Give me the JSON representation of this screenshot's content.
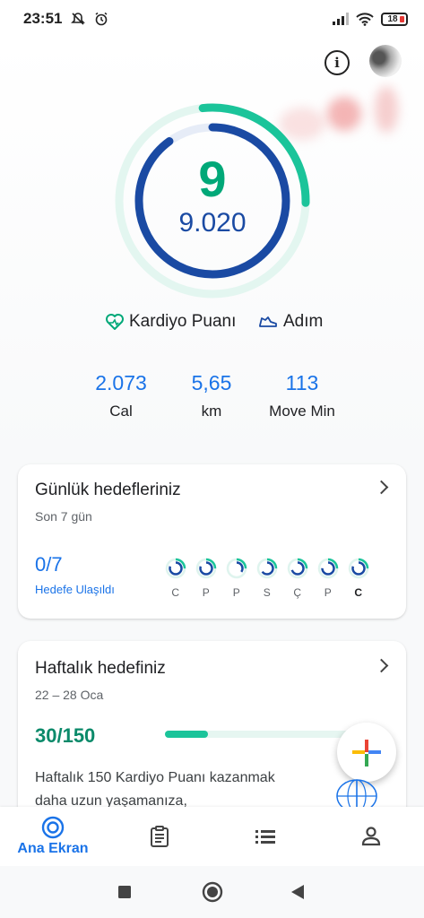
{
  "status_bar": {
    "time": "23:51",
    "battery": "18"
  },
  "ring": {
    "cardio_points": "9",
    "steps": "9.020",
    "cardio_progress": 0.27,
    "steps_progress": 0.9
  },
  "legend": {
    "cardio_label": "Kardiyo Puanı",
    "steps_label": "Adım"
  },
  "stats": [
    {
      "value": "2.073",
      "label": "Cal"
    },
    {
      "value": "5,65",
      "label": "km"
    },
    {
      "value": "113",
      "label": "Move Min"
    }
  ],
  "daily_card": {
    "title": "Günlük hedefleriniz",
    "subtitle": "Son 7 gün",
    "achieved": "0/7",
    "achieved_label": "Hedefe Ulaşıldı",
    "days": [
      {
        "label": "C",
        "progress": 0.8,
        "today": false
      },
      {
        "label": "P",
        "progress": 0.8,
        "today": false
      },
      {
        "label": "P",
        "progress": 0.35,
        "today": false
      },
      {
        "label": "S",
        "progress": 0.65,
        "today": false
      },
      {
        "label": "Ç",
        "progress": 0.7,
        "today": false
      },
      {
        "label": "P",
        "progress": 0.75,
        "today": false
      },
      {
        "label": "C",
        "progress": 0.8,
        "today": true
      }
    ]
  },
  "weekly_card": {
    "title": "Haftalık hedefiniz",
    "date_range": "22 – 28 Oca",
    "progress_text": "30/150",
    "progress_fraction": 0.2,
    "description": "Haftalık 150 Kardiyo Puanı kazanmak daha uzun yaşamanıza,"
  },
  "bottom_nav": {
    "home_label": "Ana Ekran"
  },
  "colors": {
    "accent_blue": "#1a73e8",
    "cardio_green": "#00a878",
    "steps_navy": "#1a4aa3"
  },
  "icons": [
    "no-alarm-icon",
    "alarm-icon",
    "signal-icon",
    "wifi-icon",
    "battery-icon",
    "info-icon",
    "avatar",
    "heart-icon",
    "shoe-icon",
    "chevron-right-icon",
    "add-icon",
    "who-logo",
    "home-icon",
    "journal-icon",
    "browse-icon",
    "profile-icon",
    "recents-icon",
    "home-circle-icon",
    "back-icon"
  ]
}
